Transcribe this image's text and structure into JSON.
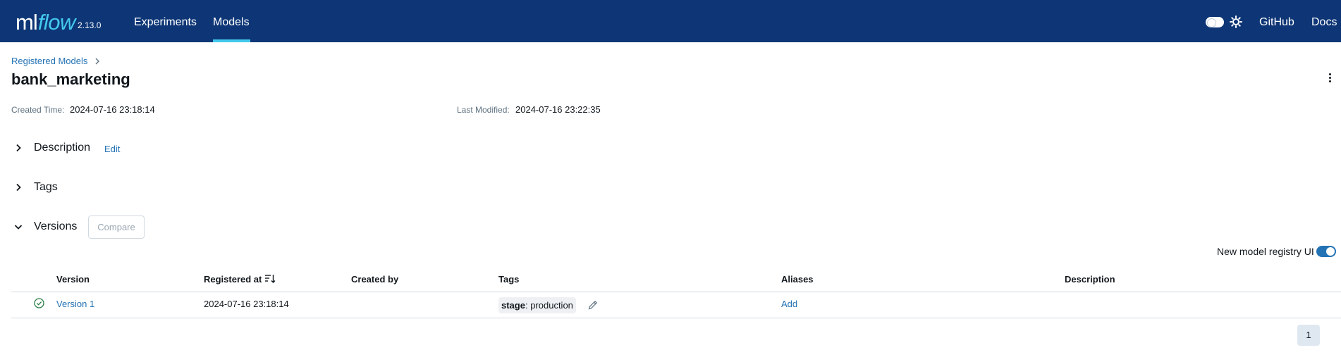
{
  "app": {
    "logo_ml": "ml",
    "logo_flow": "flow",
    "version": "2.13.0",
    "brand_color": "#0e3676",
    "accent_color": "#43c9ed",
    "link_color": "#2272b4"
  },
  "nav": {
    "items": [
      {
        "label": "Experiments",
        "active": false
      },
      {
        "label": "Models",
        "active": true
      }
    ],
    "right": [
      {
        "label": "GitHub"
      },
      {
        "label": "Docs"
      }
    ],
    "icons": [
      "theme-toggle",
      "sun-icon"
    ]
  },
  "breadcrumb": {
    "items": [
      {
        "label": "Registered Models"
      }
    ]
  },
  "page": {
    "title": "bank_marketing",
    "created_label": "Created Time:",
    "created_value": "2024-07-16 23:18:14",
    "modified_label": "Last Modified:",
    "modified_value": "2024-07-16 23:22:35"
  },
  "sections": {
    "description": {
      "title": "Description",
      "edit_label": "Edit",
      "expanded": false
    },
    "tags": {
      "title": "Tags",
      "expanded": false
    },
    "versions": {
      "title": "Versions",
      "compare_label": "Compare",
      "expanded": true
    }
  },
  "registry_toggle": {
    "label": "New model registry UI",
    "enabled": true
  },
  "table": {
    "headers": [
      "Version",
      "Registered at",
      "Created by",
      "Tags",
      "Aliases",
      "Description"
    ],
    "rows": [
      {
        "status": "ready",
        "version": "Version 1",
        "registered_at": "2024-07-16 23:18:14",
        "created_by": "",
        "tag_key": "stage",
        "tag_value": ": production",
        "aliases": "Add",
        "description": ""
      }
    ]
  },
  "pagination": {
    "current_page": "1"
  }
}
